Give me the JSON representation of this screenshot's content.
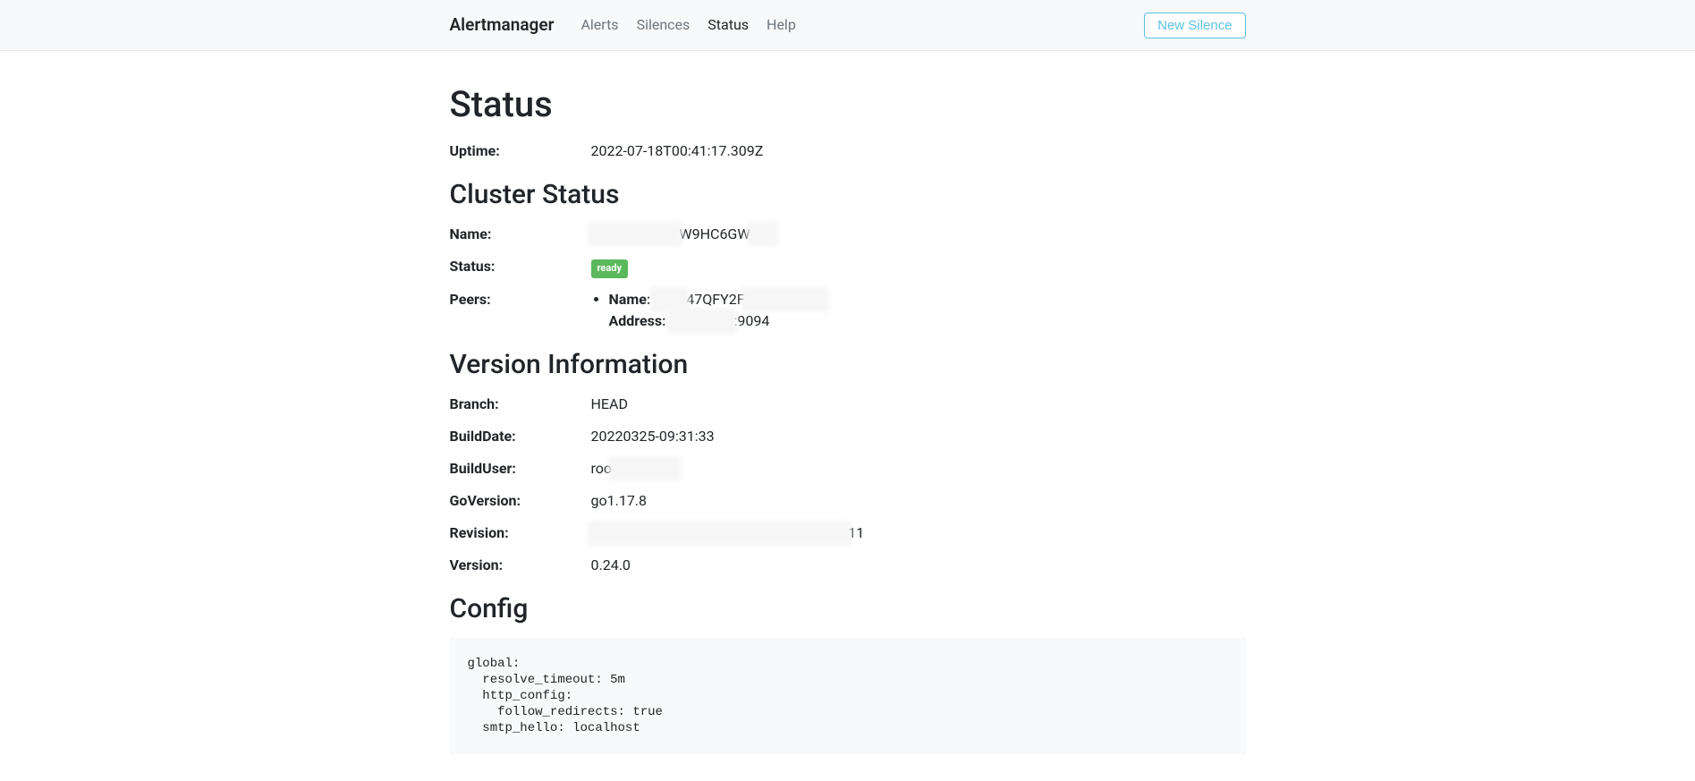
{
  "nav": {
    "brand": "Alertmanager",
    "links": [
      {
        "label": "Alerts",
        "active": false
      },
      {
        "label": "Silences",
        "active": false
      },
      {
        "label": "Status",
        "active": true
      },
      {
        "label": "Help",
        "active": false
      }
    ],
    "new_silence_label": "New Silence"
  },
  "status": {
    "heading": "Status",
    "uptime_label": "Uptime:",
    "uptime_value": "2022-07-18T00:41:17.309Z"
  },
  "cluster": {
    "heading": "Cluster Status",
    "name_label": "Name:",
    "name_value_partial": "W9HC6GW",
    "status_label": "Status:",
    "status_badge": "ready",
    "peers_label": "Peers:",
    "peers": [
      {
        "name_label": "Name:",
        "name_value_partial": "47QFY2F",
        "address_label": "Address:",
        "address_value_partial": ":9094"
      }
    ]
  },
  "version": {
    "heading": "Version Information",
    "rows": [
      {
        "label": "Branch:",
        "value": "HEAD"
      },
      {
        "label": "BuildDate:",
        "value": "20220325-09:31:33"
      },
      {
        "label": "BuildUser:",
        "value": "roo",
        "partial_blurred": true
      },
      {
        "label": "GoVersion:",
        "value": "go1.17.8"
      },
      {
        "label": "Revision:",
        "value": "11",
        "partial_blurred": true
      },
      {
        "label": "Version:",
        "value": "0.24.0"
      }
    ]
  },
  "config": {
    "heading": "Config",
    "text": "global:\n  resolve_timeout: 5m\n  http_config:\n    follow_redirects: true\n  smtp_hello: localhost"
  }
}
